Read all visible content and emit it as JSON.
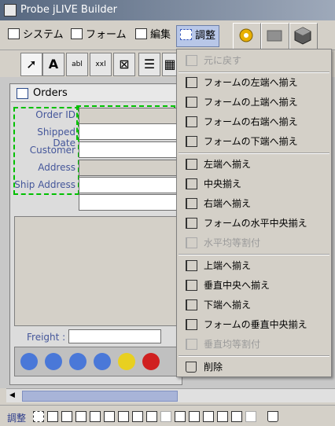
{
  "app": {
    "title": "Probe jLIVE Builder"
  },
  "menubar": {
    "items": [
      "システム",
      "フォーム",
      "編集",
      "調整"
    ]
  },
  "form": {
    "title": "Orders",
    "fields": [
      "Order ID",
      "Shipped Date",
      "Customer",
      "Address",
      "Ship Address"
    ],
    "freight_label": "Freight :"
  },
  "dropdown": {
    "undo": "元に戻す",
    "group1": [
      "フォームの左端へ揃え",
      "フォームの上端へ揃え",
      "フォームの右端へ揃え",
      "フォームの下端へ揃え"
    ],
    "group2": [
      "左端へ揃え",
      "中央揃え",
      "右端へ揃え",
      "フォームの水平中央揃え",
      "水平均等割付"
    ],
    "group3": [
      "上端へ揃え",
      "垂直中央へ揃え",
      "下端へ揃え",
      "フォームの垂直中央揃え",
      "垂直均等割付"
    ],
    "delete": "削除"
  },
  "status": {
    "label": "調整"
  },
  "colors": {
    "menu_active": "#b8c7e8",
    "selection": "#00c000",
    "label_text": "#44569a"
  }
}
